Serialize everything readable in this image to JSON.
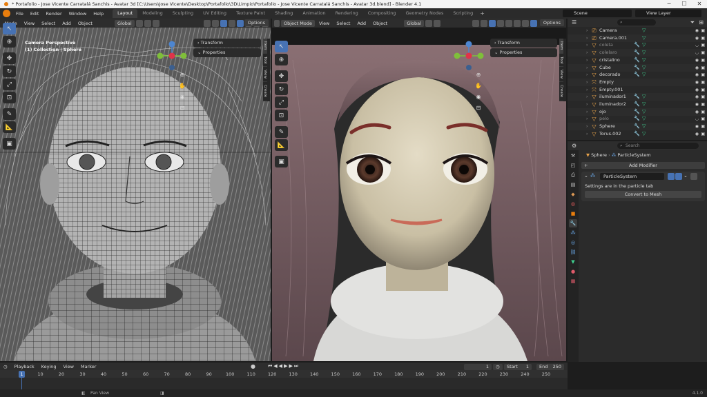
{
  "window": {
    "title": "* Portafolio - Jose Vicente Carratalá Sanchis - Avatar 3d [C:\\Users\\Jose Vicente\\Desktop\\Portafolio\\3D\\Limpio\\Portafolio - Jose Vicente Carratalá Sanchis - Avatar 3d.blend] - Blender 4.1"
  },
  "menu": [
    "File",
    "Edit",
    "Render",
    "Window",
    "Help"
  ],
  "workspaces": [
    "Layout",
    "Modeling",
    "Sculpting",
    "UV Editing",
    "Texture Paint",
    "Shading",
    "Animation",
    "Rendering",
    "Compositing",
    "Geometry Nodes",
    "Scripting"
  ],
  "active_workspace": "Layout",
  "scene": "Scene",
  "view_layer": "View Layer",
  "left_viewport": {
    "mode": "Mode",
    "menus": [
      "View",
      "Select",
      "Add",
      "Object"
    ],
    "orientation": "Global",
    "options": "Options",
    "overlay_line1": "Camera Perspective",
    "overlay_line2": "(1) Collection | Sphere",
    "panels": [
      "Transform",
      "Properties"
    ],
    "sidetabs": [
      "Item",
      "Tool",
      "View",
      "Create"
    ]
  },
  "right_viewport": {
    "mode": "Object Mode",
    "menus": [
      "View",
      "Select",
      "Add",
      "Object"
    ],
    "orientation": "Global",
    "options": "Options",
    "panels": [
      "Transform",
      "Properties"
    ],
    "sidetabs": [
      "Item",
      "Tool",
      "View",
      "Create"
    ]
  },
  "outliner": {
    "search_placeholder": "",
    "items": [
      {
        "name": "Camera",
        "icon": "camera-icon",
        "muted": false
      },
      {
        "name": "Camera.001",
        "icon": "camera-icon",
        "muted": false
      },
      {
        "name": "coleta",
        "icon": "mesh-icon",
        "muted": true
      },
      {
        "name": "colelaro",
        "icon": "mesh-icon",
        "muted": true
      },
      {
        "name": "cristalino",
        "icon": "mesh-icon",
        "muted": false
      },
      {
        "name": "Cube",
        "icon": "mesh-icon",
        "muted": false
      },
      {
        "name": "decorado",
        "icon": "mesh-icon",
        "muted": false
      },
      {
        "name": "Empty",
        "icon": "empty-icon",
        "muted": false
      },
      {
        "name": "Empty.001",
        "icon": "empty-icon",
        "muted": false
      },
      {
        "name": "iluminador1",
        "icon": "mesh-icon",
        "muted": false
      },
      {
        "name": "iluminador2",
        "icon": "mesh-icon",
        "muted": false
      },
      {
        "name": "ojo",
        "icon": "mesh-icon",
        "muted": false
      },
      {
        "name": "pelo",
        "icon": "mesh-icon",
        "muted": true
      },
      {
        "name": "Sphere",
        "icon": "mesh-icon",
        "muted": false
      },
      {
        "name": "Torus.002",
        "icon": "mesh-icon",
        "muted": false
      }
    ]
  },
  "properties": {
    "search_placeholder": "Search",
    "object": "Sphere",
    "modifier_name": "ParticleSystem",
    "add_modifier": "Add Modifier",
    "info": "Settings are in the particle tab",
    "convert": "Convert to Mesh"
  },
  "timeline": {
    "menus": [
      "Playback",
      "Keying",
      "View",
      "Marker"
    ],
    "current_frame": "1",
    "start_label": "Start",
    "start": "1",
    "end_label": "End",
    "end": "250",
    "ticks": [
      "1",
      "10",
      "20",
      "30",
      "40",
      "50",
      "60",
      "70",
      "80",
      "90",
      "100",
      "110",
      "120",
      "130",
      "140",
      "150",
      "160",
      "170",
      "180",
      "190",
      "200",
      "210",
      "220",
      "230",
      "240",
      "250"
    ],
    "playhead": "1"
  },
  "status": {
    "hint": "Pan View",
    "version": "4.1.0"
  }
}
